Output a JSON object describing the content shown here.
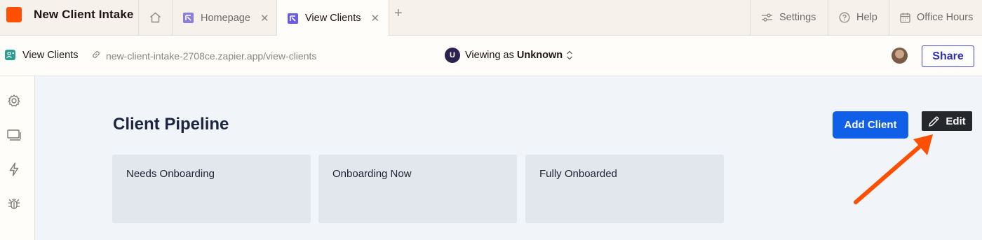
{
  "app": {
    "title": "New Client Intake",
    "brand_color": "#ff4f00"
  },
  "tabs": [
    {
      "label": "Homepage",
      "active": false
    },
    {
      "label": "View Clients",
      "active": true
    }
  ],
  "header_right": {
    "settings": "Settings",
    "help": "Help",
    "office_hours": "Office Hours"
  },
  "subbar": {
    "page_name": "View Clients",
    "url": "new-client-intake-2708ce.zapier.app/view-clients",
    "viewer_initial": "U",
    "viewing_prefix": "Viewing as",
    "viewing_user": "Unknown",
    "share_label": "Share"
  },
  "leftrail": {
    "icons": [
      "gear-icon",
      "screen-icon",
      "lightning-icon",
      "bug-icon"
    ]
  },
  "main": {
    "title": "Client Pipeline",
    "add_button": "Add Client",
    "edit_button": "Edit",
    "columns": [
      {
        "label": "Needs Onboarding"
      },
      {
        "label": "Onboarding Now"
      },
      {
        "label": "Fully Onboarded"
      }
    ],
    "annotation_color": "#ff4f00"
  }
}
